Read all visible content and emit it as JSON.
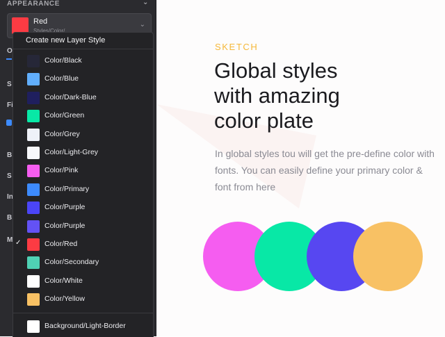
{
  "panel": {
    "section_title": "APPEARANCE",
    "selected_style": {
      "name": "Red",
      "path": "Styles/Color/",
      "color": "#fc3b43"
    },
    "side_letters": [
      "O",
      "S",
      "Fi",
      "B",
      "S",
      "In",
      "B",
      "M"
    ]
  },
  "menu": {
    "header": "Create new Layer Style",
    "items": [
      {
        "label": "Color/Black",
        "color": "#262738",
        "checked": false
      },
      {
        "label": "Color/Blue",
        "color": "#61aefc",
        "checked": false
      },
      {
        "label": "Color/Dark-Blue",
        "color": "#1f1f5e",
        "checked": false
      },
      {
        "label": "Color/Green",
        "color": "#08e8a6",
        "checked": false
      },
      {
        "label": "Color/Grey",
        "color": "#eef1f8",
        "checked": false
      },
      {
        "label": "Color/Light-Grey",
        "color": "#f7f8fb",
        "checked": false
      },
      {
        "label": "Color/Pink",
        "color": "#f55df0",
        "checked": false
      },
      {
        "label": "Color/Primary",
        "color": "#3d8bfd",
        "checked": false
      },
      {
        "label": "Color/Purple",
        "color": "#4b45f6",
        "checked": false
      },
      {
        "label": "Color/Purple",
        "color": "#6352f5",
        "checked": false
      },
      {
        "label": "Color/Red",
        "color": "#fc3b43",
        "checked": true
      },
      {
        "label": "Color/Secondary",
        "color": "#4fd1b4",
        "checked": false
      },
      {
        "label": "Color/White",
        "color": "#ffffff",
        "checked": false
      },
      {
        "label": "Color/Yellow",
        "color": "#f8c164",
        "checked": false
      }
    ],
    "bottom_item": {
      "label": "Background/Light-Border",
      "color": "#ffffff"
    },
    "check_glyph": "✓"
  },
  "hero": {
    "kicker": "SKETCH",
    "headline": [
      "Global styles",
      "with amazing",
      "color plate"
    ],
    "body": "In global styles tou will get the pre-define color with fonts. You can easily define your primary color & font from here",
    "circles": [
      {
        "name": "pink",
        "color": "#f55df0"
      },
      {
        "name": "green",
        "color": "#08e8a6"
      },
      {
        "name": "purple",
        "color": "#5747f1"
      },
      {
        "name": "yellow",
        "color": "#f8c164"
      }
    ]
  }
}
